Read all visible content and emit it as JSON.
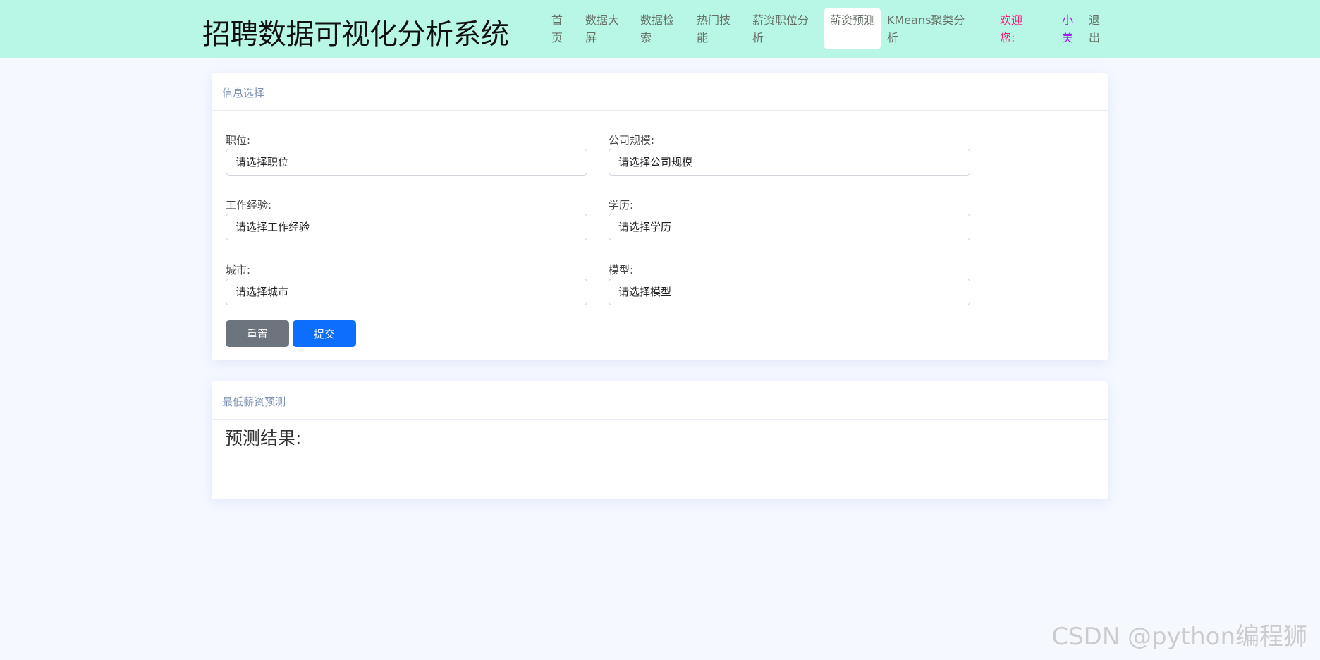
{
  "header": {
    "title": "招聘数据可视化分析系统",
    "nav": [
      {
        "label": "首页"
      },
      {
        "label": "数据大屏"
      },
      {
        "label": "数据检索"
      },
      {
        "label": "热门技能"
      },
      {
        "label": "薪资职位分析"
      },
      {
        "label": "薪资预测",
        "active": true
      },
      {
        "label": "KMeans聚类分析"
      }
    ],
    "welcome": "欢迎您:",
    "username": "小美",
    "logout": "退出"
  },
  "form_card": {
    "title": "信息选择",
    "fields": [
      {
        "label": "职位:",
        "placeholder": "请选择职位"
      },
      {
        "label": "公司规模:",
        "placeholder": "请选择公司规模"
      },
      {
        "label": "工作经验:",
        "placeholder": "请选择工作经验"
      },
      {
        "label": "学历:",
        "placeholder": "请选择学历"
      },
      {
        "label": "城市:",
        "placeholder": "请选择城市"
      },
      {
        "label": "模型:",
        "placeholder": "请选择模型"
      }
    ],
    "reset_label": "重置",
    "submit_label": "提交"
  },
  "result_card": {
    "title": "最低薪资预测",
    "result_label": "预测结果:"
  },
  "watermark": "CSDN @python编程狮",
  "colors": {
    "header_bg": "#b8f7e6",
    "welcome": "#ff1a7a",
    "username": "#a020f0",
    "primary": "#0d6efd",
    "secondary": "#6c757d"
  }
}
